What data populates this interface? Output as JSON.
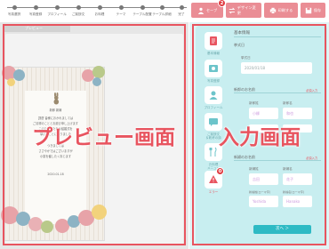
{
  "stepper": {
    "steps": [
      {
        "label": "写真選択"
      },
      {
        "label": "写真登録"
      },
      {
        "label": "プロフィール"
      },
      {
        "label": "ご挨拶文"
      },
      {
        "label": "お料理"
      },
      {
        "label": "テーマ"
      },
      {
        "label": "テーブル配置"
      },
      {
        "label": "テーブル詳細"
      },
      {
        "label": "完了"
      }
    ]
  },
  "toolbar": {
    "save_prev": {
      "label": "セーブ",
      "badge": "2"
    },
    "change_design": {
      "label": "デザイン変更"
    },
    "print": {
      "label": "印刷する"
    },
    "save": {
      "label": "保存"
    }
  },
  "preview": {
    "tab_label": "プレビュー",
    "card": {
      "line1": "新郎 新婦",
      "line2": "謹啓 皆様におかれましては",
      "line3": "ご清祥のこととお慶び申し上げます",
      "line4": "このたび私たちは結婚式を",
      "line5": "挙げることになりました",
      "line6": "つきましては",
      "line7": "ささやかではございますが",
      "line8": "小宴を催したく存じます",
      "date": "2020.01.18"
    }
  },
  "input": {
    "nav": [
      {
        "label": "基本情報"
      },
      {
        "label": "写真登録"
      },
      {
        "label": "プロフィール"
      },
      {
        "label": "ご挨拶文\n＆乾杯の詩"
      },
      {
        "label": "お料理\nメニュー"
      },
      {
        "label": "エラー",
        "badge": "0"
      }
    ],
    "form": {
      "section_basic": "基本情報",
      "wedding_date_label": "挙式日",
      "wedding_date_sub": "挙式日",
      "wedding_date_value": "2020/01/18",
      "groom_section": "新郎のお名前",
      "groom_last_label": "新郎姓",
      "groom_first_label": "新郎名",
      "groom_last_ph": "小柳",
      "groom_first_ph": "和也",
      "required": "必須入力",
      "bride_section": "新婦のお名前",
      "bride_last_label": "新婦姓",
      "bride_first_label": "新婦名",
      "bride_last_ph": "吉田",
      "bride_first_ph": "花子",
      "bride_last_kana_label": "新婦姓(ローマ字)",
      "bride_first_kana_label": "新婦名(ローマ字)",
      "bride_last_kana_ph": "Yoshida",
      "bride_first_kana_ph": "Hanako",
      "next_label": "次へ ＞"
    }
  },
  "overlay": {
    "preview_caption": "プレビュー画面",
    "input_caption": "入力画面"
  },
  "colors": {
    "accent_pink": "#e8545f",
    "button_pink": "#ea8d95",
    "panel_cyan": "#c8eef0",
    "next_button": "#2ebac4"
  }
}
